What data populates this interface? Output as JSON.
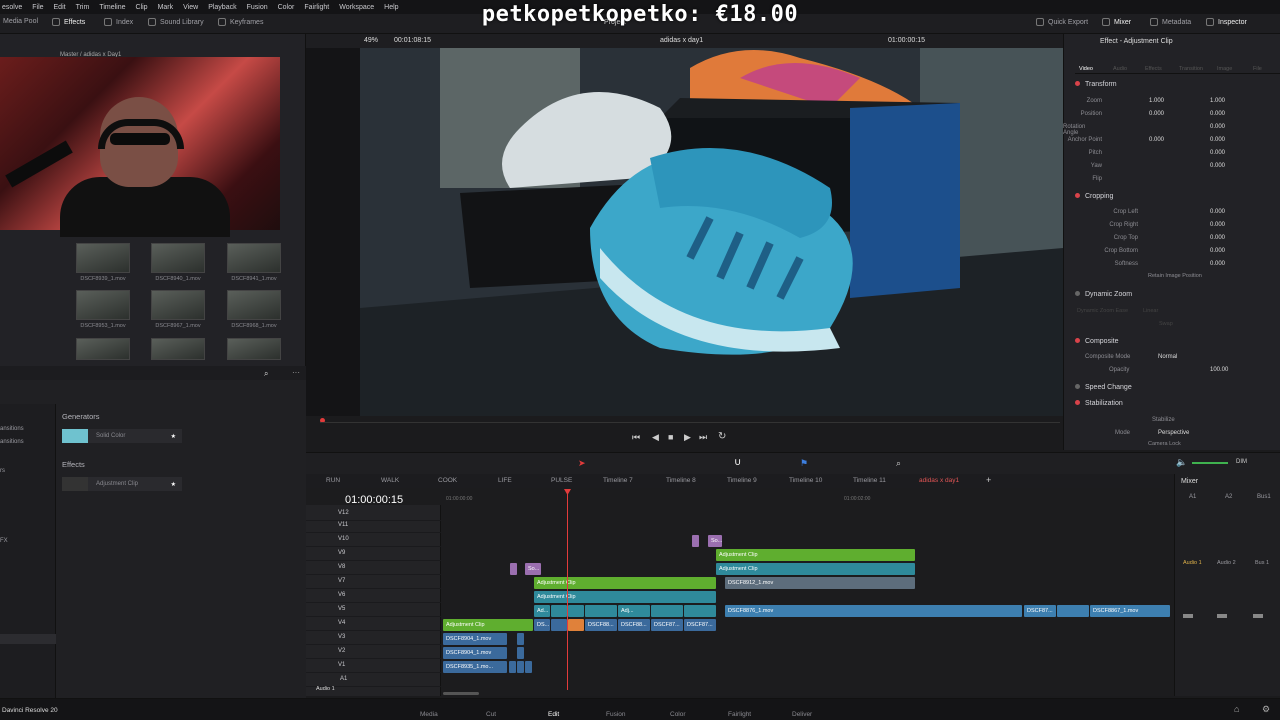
{
  "overlay_text": "petkopetkopetko: €18.00",
  "menu": [
    "esolve",
    "File",
    "Edit",
    "Trim",
    "Timeline",
    "Clip",
    "Mark",
    "View",
    "Playback",
    "Fusion",
    "Color",
    "Fairlight",
    "Workspace",
    "Help"
  ],
  "toolbar": {
    "media_pool": "Media Pool",
    "effects": "Effects",
    "index": "Index",
    "sound_library": "Sound Library",
    "keyframes": "Keyframes",
    "project": "Project",
    "quick_export": "Quick Export",
    "mixer": "Mixer",
    "metadata": "Metadata",
    "inspector": "Inspector"
  },
  "viewer": {
    "zoom": "49%",
    "source_tc": "00:01:08:15",
    "title": "adidas x day1",
    "timecode": "01:00:00:15"
  },
  "media_pool": {
    "breadcrumb": "Master / adidas x Day1",
    "clips": [
      "DSCF8939_1.mov",
      "DSCF8940_1.mov",
      "DSCF8941_1.mov",
      "DSCF8953_1.mov",
      "DSCF8967_1.mov",
      "DSCF8968_1.mov"
    ]
  },
  "effects": {
    "side_items": [
      "ansitions",
      "ansitions",
      "rs",
      "FX"
    ],
    "generators_label": "Generators",
    "solid_color": "Solid Color",
    "effects_label": "Effects",
    "adjustment_clip": "Adjustment Clip"
  },
  "inspector": {
    "title": "Effect - Adjustment Clip",
    "tabs": [
      "Video",
      "Audio",
      "Effects",
      "Transition",
      "Image",
      "File"
    ],
    "transform": "Transform",
    "zoom": {
      "label": "Zoom",
      "x": "1.000",
      "y": "1.000"
    },
    "position": {
      "label": "Position",
      "x": "0.000",
      "y": "0.000"
    },
    "rotation": {
      "label": "Rotation Angle",
      "v": "0.000"
    },
    "anchor": {
      "label": "Anchor Point",
      "x": "0.000",
      "y": "0.000"
    },
    "pitch": {
      "label": "Pitch",
      "v": "0.000"
    },
    "yaw": {
      "label": "Yaw",
      "v": "0.000"
    },
    "flip": "Flip",
    "cropping": "Cropping",
    "crop_left": {
      "label": "Crop Left",
      "v": "0.000"
    },
    "crop_right": {
      "label": "Crop Right",
      "v": "0.000"
    },
    "crop_top": {
      "label": "Crop Top",
      "v": "0.000"
    },
    "crop_bottom": {
      "label": "Crop Bottom",
      "v": "0.000"
    },
    "softness": {
      "label": "Softness",
      "v": "0.000"
    },
    "retain": "Retain Image Position",
    "dynamic_zoom": "Dynamic Zoom",
    "dz_ease": "Dynamic Zoom Ease",
    "dz_linear": "Linear",
    "swap": "Swap",
    "composite": "Composite",
    "composite_mode": {
      "label": "Composite Mode",
      "v": "Normal"
    },
    "opacity": {
      "label": "Opacity",
      "v": "100.00"
    },
    "speed_change": "Speed Change",
    "stabilization": "Stabilization",
    "stabilize": "Stabilize",
    "mode": {
      "label": "Mode",
      "v": "Perspective"
    },
    "camera_lock": "Camera Lock"
  },
  "timeline": {
    "timecode": "01:00:00:15",
    "ruler": [
      "01:00:00:00",
      "01:00:02:00"
    ],
    "tabs": [
      "RUN",
      "WALK",
      "COOK",
      "LIFE",
      "PULSE",
      "Timeline 7",
      "Timeline 8",
      "Timeline 9",
      "Timeline 10",
      "Timeline 11",
      "adidas x day1"
    ],
    "tracks": [
      "V12",
      "V11",
      "V10",
      "V9",
      "V8",
      "V7",
      "V6",
      "V5",
      "V4",
      "V3",
      "V2",
      "V1",
      "A1"
    ],
    "clips": {
      "adj1": "Adjustment Clip",
      "adj2": "Adjustment Clip",
      "adj3": "Adjustment Clip",
      "adj4": "Adjustment Clip",
      "adj5": "Adjustment Clip",
      "so1": "So...",
      "so2": "So...",
      "dscf8912": "DSCF8912_1.mov",
      "dscf8876": "DSCF8876_1.mov",
      "dscf8904a": "DSCF8904_1.mov",
      "dscf8904b": "DSCF8904_1.mov",
      "dscf8935": "DSCF8935_1.mo...",
      "dscf88a": "DSCF88...",
      "dscf88b": "DSCF88...",
      "dscf87a": "DSCF87...",
      "dscf87b": "DSCF87...",
      "dscf87c": "DSCF87...",
      "dscf8867": "DSCF8867_1.mov",
      "ad": "Ad...",
      "adj": "Adj...",
      "ds": "DS..."
    },
    "audio_label": "Audio 1",
    "dim": "DIM"
  },
  "mixer": {
    "title": "Mixer",
    "channels": [
      "A1",
      "A2",
      "Bus1"
    ],
    "names": [
      "Audio 1",
      "Audio 2",
      "Bus 1"
    ]
  },
  "bottom": {
    "app": "Davinci Resolve 20",
    "pages": [
      "Media",
      "Cut",
      "Edit",
      "Fusion",
      "Color",
      "Fairlight",
      "Deliver"
    ]
  }
}
